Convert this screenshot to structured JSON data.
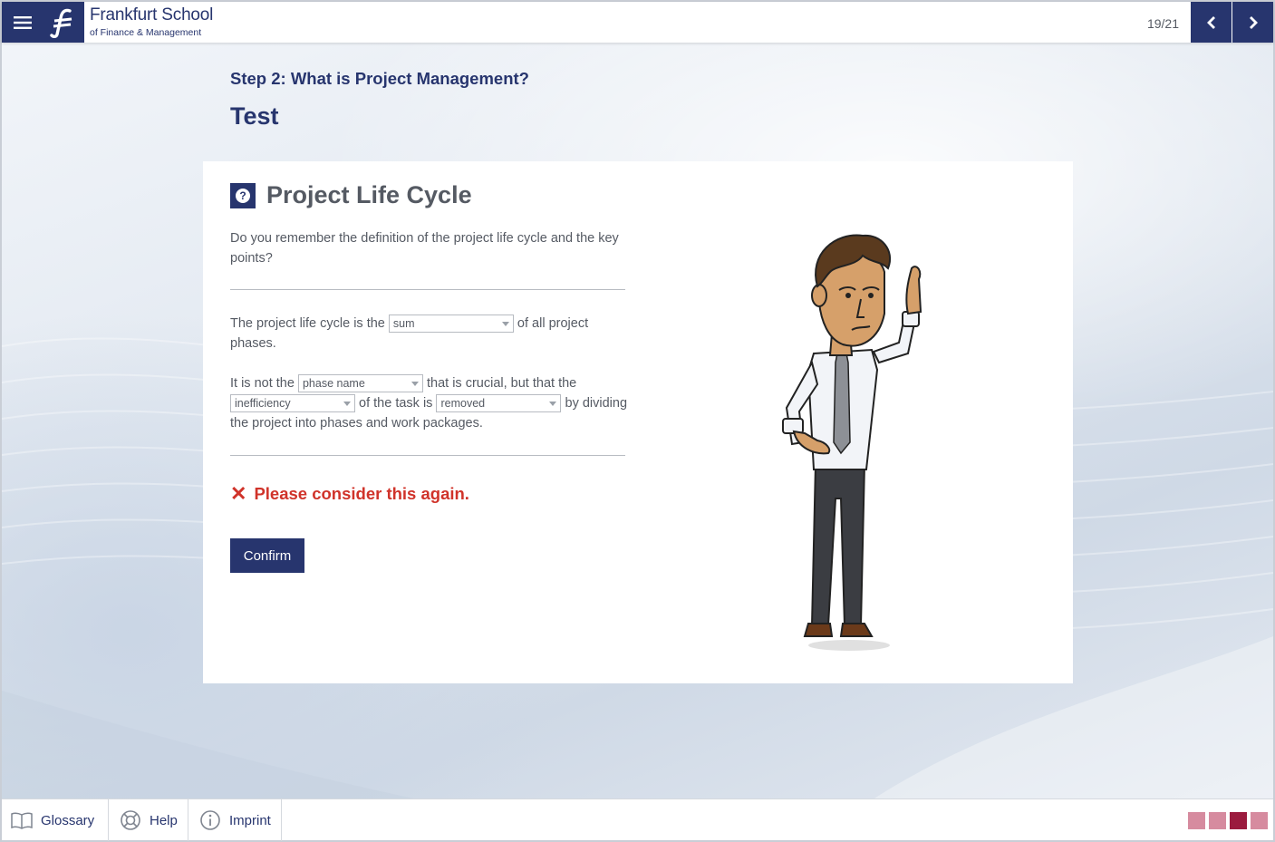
{
  "header": {
    "brand_title": "Frankfurt School",
    "brand_subtitle": "of Finance & Management",
    "page_counter": "19/21"
  },
  "content": {
    "step_title": "Step 2: What is Project Management?",
    "section_title": "Test",
    "card_title": "Project Life Cycle",
    "intro": "Do you remember the definition of the project life cycle and the key points?",
    "s1_a": "The project life cycle is the",
    "s1_b": "of all project phases.",
    "s2_a": "It is not the",
    "s2_b": "that is crucial, but that the",
    "s2_c": "of the task is",
    "s2_d": "by dividing the project into phases and work packages.",
    "dropdowns": {
      "sum": "sum",
      "phase_name": "phase name",
      "inefficiency": "inefficiency",
      "removed": "removed"
    },
    "feedback": "Please consider this again.",
    "feedback_icon": "✕",
    "confirm_label": "Confirm"
  },
  "footer": {
    "glossary": "Glossary",
    "help": "Help",
    "imprint": "Imprint",
    "progress_total": 4,
    "progress_current": 3
  },
  "colors": {
    "brand": "#27356e",
    "error": "#d0332a",
    "progress_done": "#d68b9f",
    "progress_current": "#9b1b3e"
  }
}
